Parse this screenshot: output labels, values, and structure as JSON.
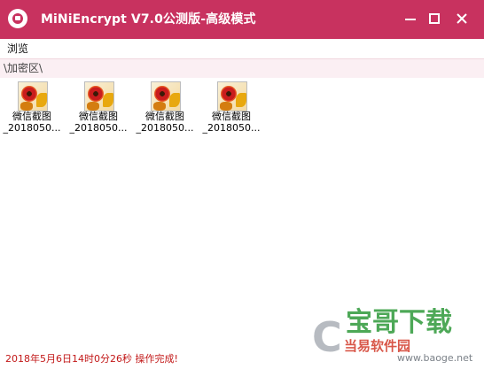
{
  "window": {
    "title": "MiNiEncrypt V7.0公测版-高级模式",
    "accent_color": "#c8325f"
  },
  "controls": {
    "minimize_icon": "minimize-icon",
    "maximize_icon": "maximize-icon",
    "close_icon": "close-icon"
  },
  "menu": {
    "items": [
      {
        "label": "浏览"
      }
    ]
  },
  "path": {
    "text": "\\加密区\\"
  },
  "files": [
    {
      "name_line1": "微信截图",
      "name_line2": "_2018050..."
    },
    {
      "name_line1": "微信截图",
      "name_line2": "_2018050..."
    },
    {
      "name_line1": "微信截图",
      "name_line2": "_2018050..."
    },
    {
      "name_line1": "微信截图",
      "name_line2": "_2018050..."
    }
  ],
  "status": {
    "text": "2018年5月6日14时0分26秒    操作完成!",
    "color": "#c21818"
  },
  "watermark": {
    "letter": "C",
    "main": "宝哥下载",
    "sub": "当易软件园",
    "url": "www.baoge.net"
  }
}
